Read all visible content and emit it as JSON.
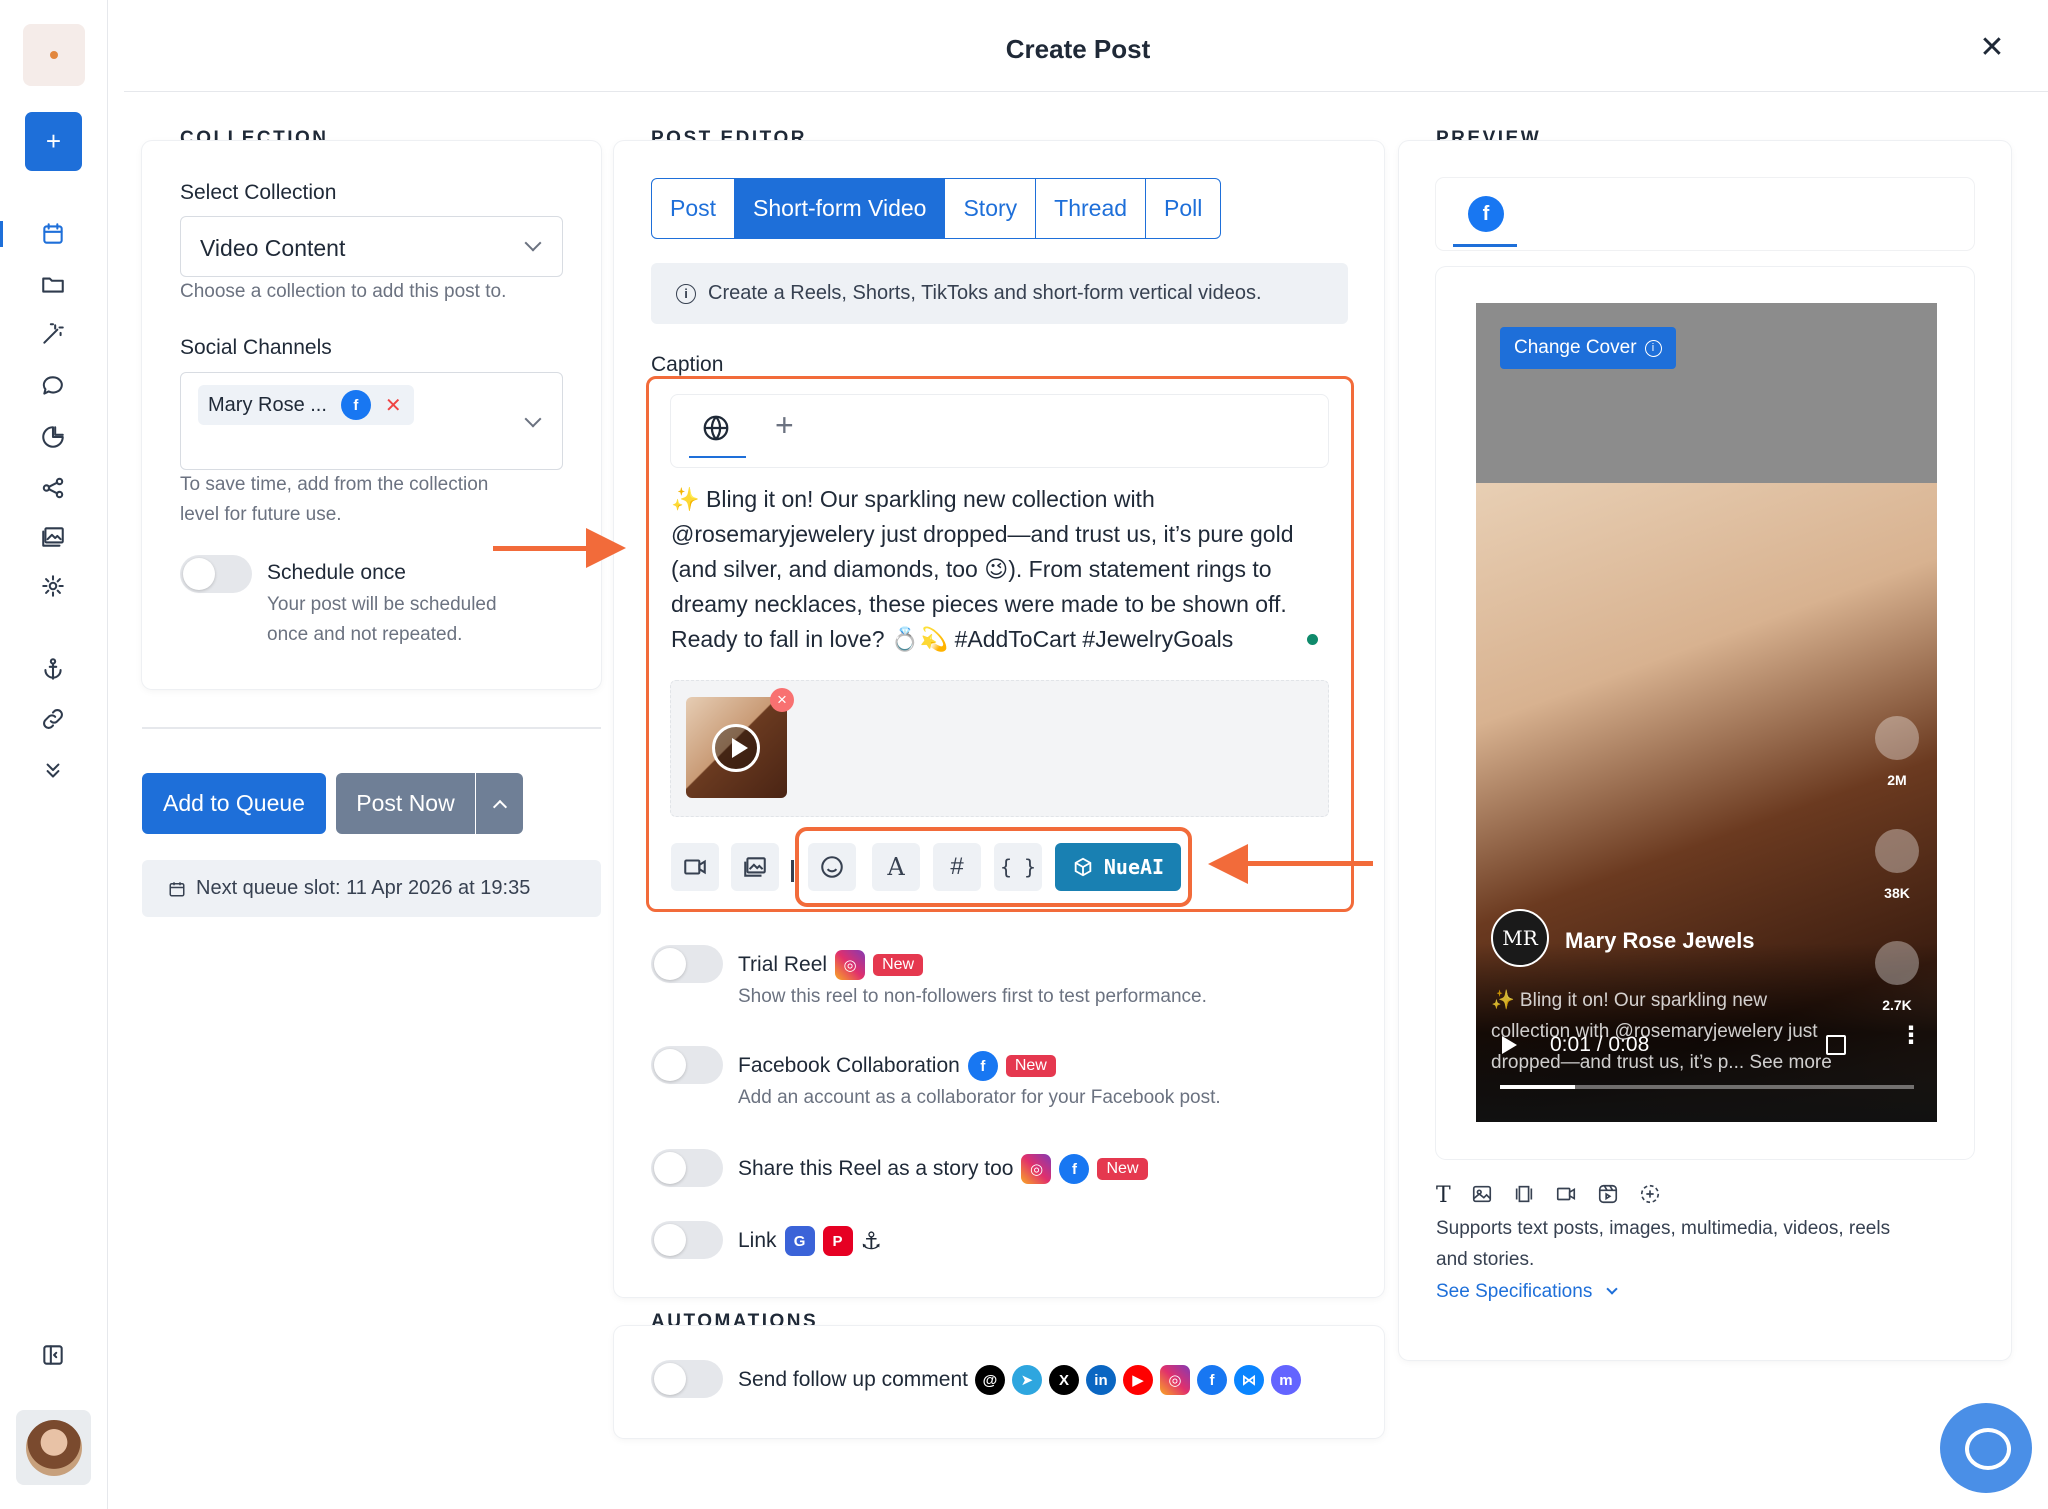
{
  "header": {
    "title": "Create Post",
    "close_icon": "✕"
  },
  "collection": {
    "section_title": "COLLECTION",
    "select_label": "Select Collection",
    "select_value": "Video Content",
    "select_help": "Choose a collection to add this post to.",
    "channels_label": "Social Channels",
    "channel_chip": "Mary Rose ...",
    "channels_help_1": "To save time, add from the collection",
    "channels_help_2": "level for future use.",
    "schedule_label": "Schedule once",
    "schedule_help_1": "Your post will be scheduled",
    "schedule_help_2": "once and not repeated."
  },
  "actions": {
    "add_to_queue": "Add to Queue",
    "post_now": "Post Now",
    "next_queue_slot": "Next queue slot: 11 Apr 2026 at 19:35"
  },
  "editor": {
    "section_title": "POST EDITOR",
    "tabs": [
      {
        "label": "Post"
      },
      {
        "label": "Short-form Video"
      },
      {
        "label": "Story"
      },
      {
        "label": "Thread"
      },
      {
        "label": "Poll"
      }
    ],
    "active_tab": "Short-form Video",
    "info": "Create a Reels, Shorts, TikToks and short-form vertical videos.",
    "caption_label": "Caption",
    "caption_lines": [
      "✨ Bling it on! Our sparkling new collection with",
      "@rosemaryjewelery just dropped—and trust us, it’s pure gold",
      "(and silver, and diamonds, too 😉). From statement rings to",
      "dreamy necklaces, these pieces were made to be shown off.",
      "Ready to fall in love? 💍💫 #AddToCart #JewelryGoals"
    ],
    "nueai_label": "NueAI",
    "tool_icons": [
      "video-icon",
      "gallery-icon",
      "emoji-icon",
      "font-icon",
      "hashtag-icon",
      "braces-icon"
    ]
  },
  "options": {
    "trial_reel": {
      "title": "Trial Reel",
      "badge": "New",
      "help": "Show this reel to non-followers first to test performance."
    },
    "fb_collab": {
      "title": "Facebook Collaboration",
      "badge": "New",
      "help": "Add an account as a collaborator for your Facebook post."
    },
    "story_too": {
      "title": "Share this Reel as a story too",
      "badge": "New"
    },
    "link": {
      "title": "Link"
    }
  },
  "automations": {
    "section_title": "AUTOMATIONS",
    "follow_up": "Send follow up comment",
    "networks": [
      "threads",
      "telegram",
      "x",
      "linkedin",
      "youtube",
      "instagram",
      "facebook",
      "bluesky",
      "mastodon"
    ]
  },
  "preview": {
    "section_title": "PREVIEW",
    "change_cover": "Change Cover",
    "account_name": "Mary Rose Jewels",
    "avatar_initials": "MR",
    "caption_1": "✨ Bling it on! Our sparkling new",
    "caption_2": "collection with @rosemaryjewelery just",
    "caption_3": "dropped—and trust us, it’s p... See more",
    "likes": "2M",
    "comments": "38K",
    "shares": "2.7K",
    "time": "0:01 / 0:08",
    "progress_fraction": 0.18,
    "supports_1": "Supports text posts, images, multimedia, videos, reels",
    "supports_2": "and stories.",
    "see_specs": "See Specifications"
  },
  "colors": {
    "accent": "#1e6fd9",
    "highlight": "#f26b3a",
    "nueai": "#1980b2",
    "new_badge": "#e5384f"
  }
}
